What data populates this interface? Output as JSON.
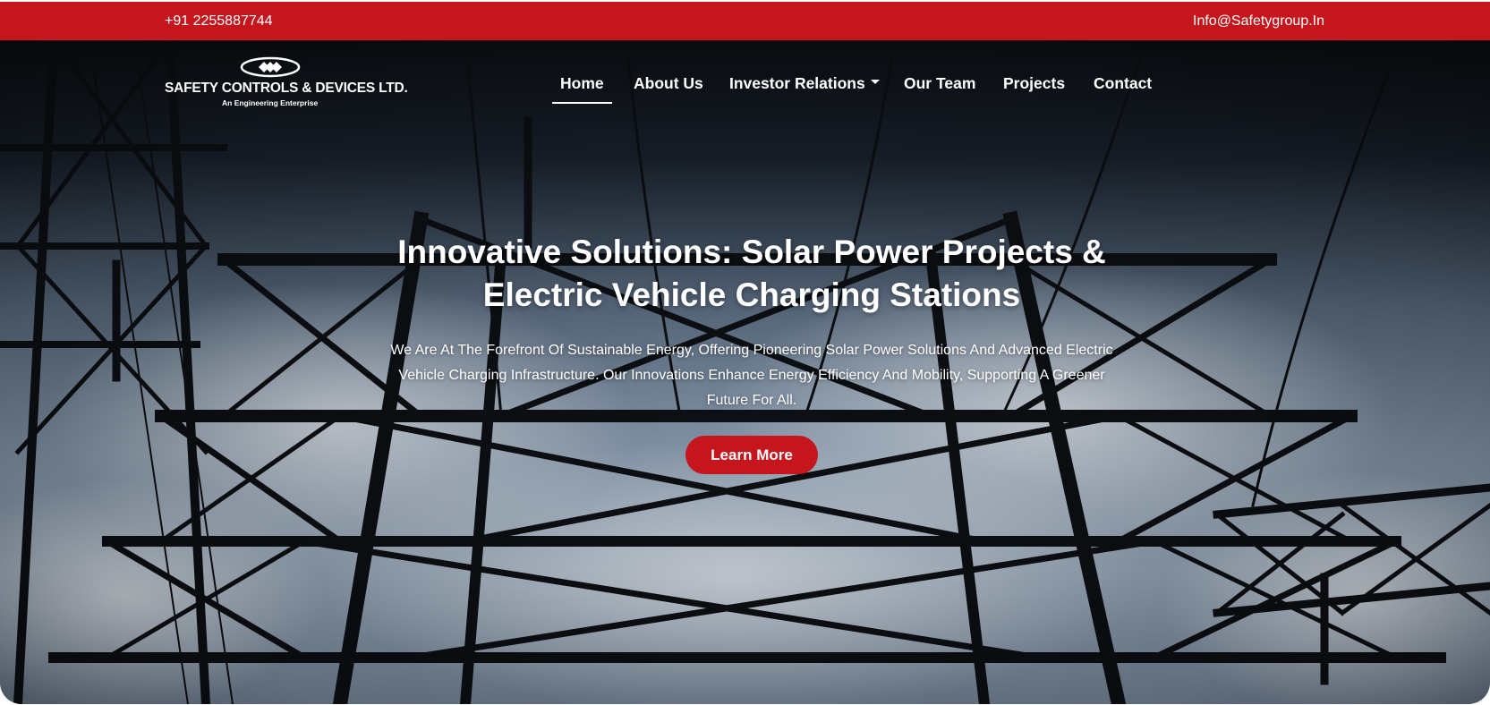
{
  "topbar": {
    "phone": "+91 2255887744",
    "email": "Info@Safetygroup.In"
  },
  "brand": {
    "name": "SAFETY CONTROLS & DEVICES LTD.",
    "tagline": "An Engineering Enterprise",
    "logo_icon": "diamond-cluster-logo"
  },
  "nav": {
    "items": [
      {
        "label": "Home",
        "active": true
      },
      {
        "label": "About Us"
      },
      {
        "label": "Investor Relations",
        "dropdown": true
      },
      {
        "label": "Our Team"
      },
      {
        "label": "Projects"
      },
      {
        "label": "Contact"
      }
    ]
  },
  "hero": {
    "headline_line1": "Innovative Solutions: Solar Power Projects &",
    "headline_line2": "Electric Vehicle Charging Stations",
    "subtext": "We Are At The Forefront Of Sustainable Energy, Offering Pioneering Solar Power Solutions And Advanced Electric Vehicle Charging Infrastructure. Our Innovations Enhance Energy Efficiency And Mobility, Supporting A Greener Future For All.",
    "cta_label": "Learn More",
    "background": "electricity-pylon-photo"
  },
  "colors": {
    "accent": "#c4161c",
    "text_light": "#ffffff"
  }
}
